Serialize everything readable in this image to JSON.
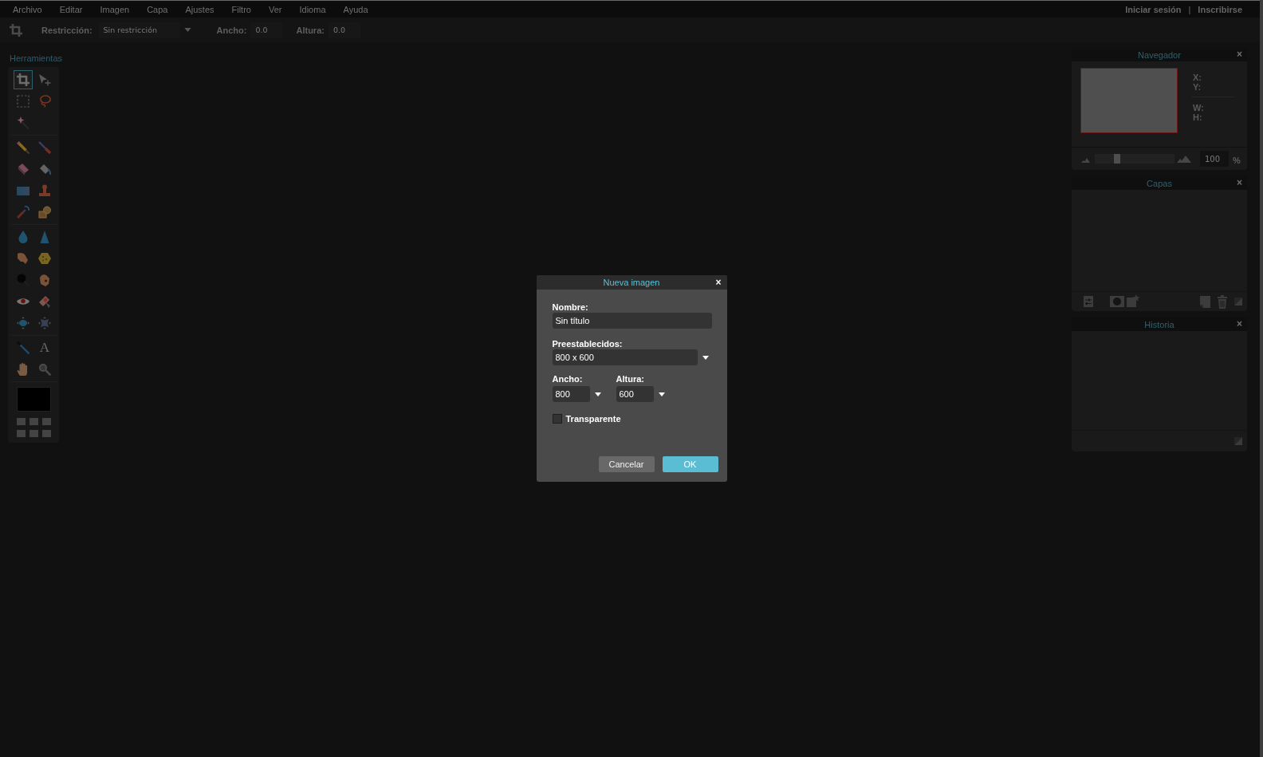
{
  "menu_bar": {
    "items": [
      "Archivo",
      "Editar",
      "Imagen",
      "Capa",
      "Ajustes",
      "Filtro",
      "Ver",
      "Idioma",
      "Ayuda"
    ],
    "account_links": [
      "Iniciar sesión",
      "Inscribirse"
    ],
    "separator": "|"
  },
  "options_bar": {
    "restriction": {
      "label": "Restricción:",
      "value": "Sin restricción"
    },
    "width": {
      "label": "Ancho:",
      "value": "0.0"
    },
    "height": {
      "label": "Altura:",
      "value": "0.0"
    }
  },
  "tools_panel": {
    "title": "Herramientas",
    "groups": [
      {
        "tools": [
          {
            "kind": "crop",
            "selected": true
          },
          {
            "kind": "move",
            "selected": false
          },
          {
            "kind": "marquee",
            "selected": false
          },
          {
            "kind": "lasso",
            "selected": false
          },
          {
            "kind": "wand",
            "selected": false
          }
        ]
      },
      {
        "tools": [
          {
            "kind": "pencil",
            "selected": false
          },
          {
            "kind": "brush",
            "selected": false
          },
          {
            "kind": "eraser",
            "selected": false
          },
          {
            "kind": "bucket",
            "selected": false
          },
          {
            "kind": "gradient",
            "selected": false
          },
          {
            "kind": "stamp",
            "selected": false
          },
          {
            "kind": "replace",
            "selected": false
          },
          {
            "kind": "shapes",
            "selected": false
          }
        ]
      },
      {
        "tools": [
          {
            "kind": "blur",
            "selected": false
          },
          {
            "kind": "sharpen",
            "selected": false
          },
          {
            "kind": "smudge",
            "selected": false
          },
          {
            "kind": "sponge",
            "selected": false
          },
          {
            "kind": "dodge",
            "selected": false
          },
          {
            "kind": "burn",
            "selected": false
          },
          {
            "kind": "redeye",
            "selected": false
          },
          {
            "kind": "heal",
            "selected": false
          },
          {
            "kind": "bloat",
            "selected": false
          },
          {
            "kind": "pinch",
            "selected": false
          }
        ]
      },
      {
        "tools": [
          {
            "kind": "picker",
            "selected": false
          },
          {
            "kind": "type",
            "label": "A",
            "selected": false
          },
          {
            "kind": "hand",
            "selected": false
          },
          {
            "kind": "zoom",
            "selected": false
          }
        ]
      }
    ],
    "color_swatch": {
      "color": "#000000"
    }
  },
  "navigator": {
    "title": "Navegador",
    "close": "×",
    "position_labels": [
      "X:",
      "Y:"
    ],
    "size_labels": [
      "W:",
      "H:"
    ],
    "zoom": {
      "level": 0.26,
      "value": "100",
      "unit": "%"
    }
  },
  "layers": {
    "title": "Capas",
    "close": "×"
  },
  "history": {
    "title": "Historia",
    "close": "×"
  },
  "dialog": {
    "title": "Nueva imagen",
    "close": "×",
    "name": {
      "label": "Nombre:",
      "value": "Sin título"
    },
    "preset": {
      "label": "Preestablecidos:",
      "value": "800 x 600"
    },
    "width": {
      "label": "Ancho:",
      "value": "800"
    },
    "height": {
      "label": "Altura:",
      "value": "600"
    },
    "transparent": {
      "label": "Transparente",
      "checked": false
    },
    "buttons": [
      {
        "label": "Cancelar",
        "kind": "secondary"
      },
      {
        "label": "OK",
        "kind": "primary"
      }
    ]
  }
}
